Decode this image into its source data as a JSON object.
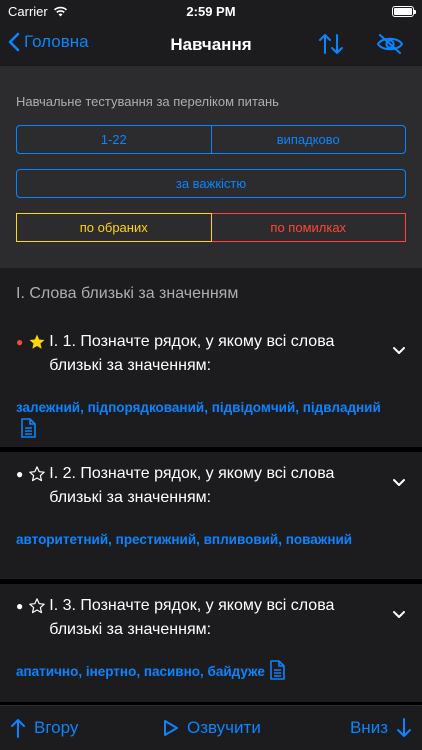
{
  "status_bar": {
    "carrier": "Carrier",
    "time": "2:59 PM"
  },
  "nav": {
    "back_label": "Головна",
    "title": "Навчання"
  },
  "filters": {
    "label": "Навчальне тестування за переліком питань",
    "range_label": "1-22",
    "random_label": "випадково",
    "difficulty_label": "за важкістю",
    "favorites_label": "по обраних",
    "errors_label": "по помилках"
  },
  "section": {
    "title": "I. Слова близькі за значенням"
  },
  "questions": [
    {
      "line1": "I. 1. Позначте рядок, у якому всі слова",
      "line2": "близькі за значенням:",
      "answer": "залежний, підпорядкований, підвідомчий, підвладний",
      "favorite": true,
      "dot_color": "#ff453a"
    },
    {
      "line1": "I. 2. Позначте рядок, у якому всі слова",
      "line2": "близькі за значенням:",
      "answer": "авторитетний, престижний, впливовий, поважний",
      "favorite": false,
      "dot_color": "#ffffff"
    },
    {
      "line1": "I. 3. Позначте рядок, у якому всі слова",
      "line2": "близькі за значенням:",
      "answer": "апатично, інертно, пасивно, байдуже",
      "favorite": false,
      "dot_color": "#ffffff"
    }
  ],
  "toolbar": {
    "up_label": "Вгору",
    "speak_label": "Озвучити",
    "down_label": "Вниз"
  },
  "colors": {
    "accent": "#0a84ff",
    "favorite": "#ffd60a",
    "error": "#ff453a",
    "background": "#1c1c1e",
    "filter_background": "#2c2c2e"
  }
}
